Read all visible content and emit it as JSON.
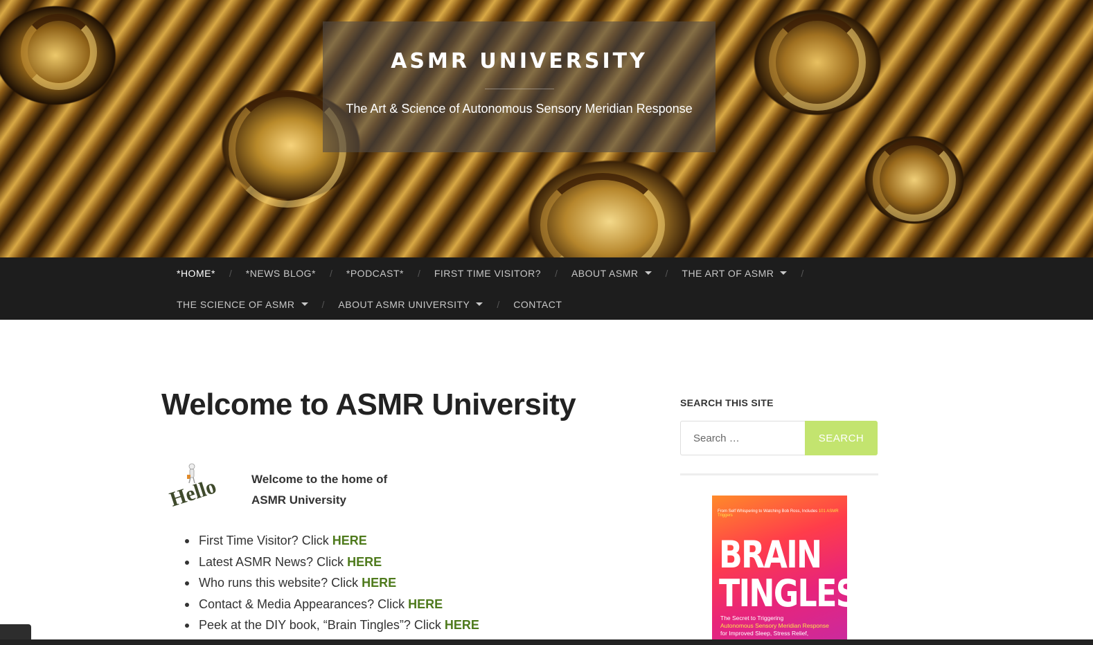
{
  "header": {
    "site_title": "ASMR UNIVERSITY",
    "site_description": "The Art & Science of Autonomous Sensory Meridian Response"
  },
  "nav": {
    "row1": [
      {
        "label": "*HOME*",
        "dropdown": false,
        "active": true
      },
      {
        "label": "*NEWS BLOG*",
        "dropdown": false
      },
      {
        "label": "*PODCAST*",
        "dropdown": false
      },
      {
        "label": "FIRST TIME VISITOR?",
        "dropdown": false
      },
      {
        "label": "ABOUT ASMR",
        "dropdown": true
      },
      {
        "label": "THE ART OF ASMR",
        "dropdown": true
      }
    ],
    "row2": [
      {
        "label": "THE SCIENCE OF ASMR",
        "dropdown": true
      },
      {
        "label": "ABOUT ASMR UNIVERSITY",
        "dropdown": true
      },
      {
        "label": "CONTACT",
        "dropdown": false
      }
    ],
    "separator": "/"
  },
  "main": {
    "title": "Welcome to ASMR University",
    "hello_image_text": "Hello",
    "welcome_line1": "Welcome to the home of",
    "welcome_line2": "ASMR University",
    "links": [
      {
        "text": "First Time Visitor?  Click ",
        "link": "HERE"
      },
      {
        "text": "Latest ASMR News?  Click ",
        "link": "HERE"
      },
      {
        "text": "Who runs this website?  Click ",
        "link": "HERE"
      },
      {
        "text": "Contact & Media Appearances? Click ",
        "link": "HERE"
      },
      {
        "text": "Peek at the DIY book, “Brain Tingles”? Click ",
        "link": "HERE"
      }
    ]
  },
  "sidebar": {
    "search_title": "SEARCH THIS SITE",
    "search_placeholder": "Search …",
    "search_button": "SEARCH",
    "book": {
      "top_line_a": "From Self Whispering to Watching Bob Ross, Includes ",
      "top_line_b": "101 ASMR Triggers",
      "title_line1": "BRAIN",
      "title_line2": "TINGLES",
      "sub_line1": "The Secret to Triggering",
      "sub_line2": "Autonomous Sensory Meridian Response",
      "sub_line3": "for Improved Sleep, Stress Relief,"
    }
  },
  "colors": {
    "nav_bg": "#1d1d1d",
    "accent_link": "#4e7a1c",
    "search_button": "#c3e46f"
  }
}
